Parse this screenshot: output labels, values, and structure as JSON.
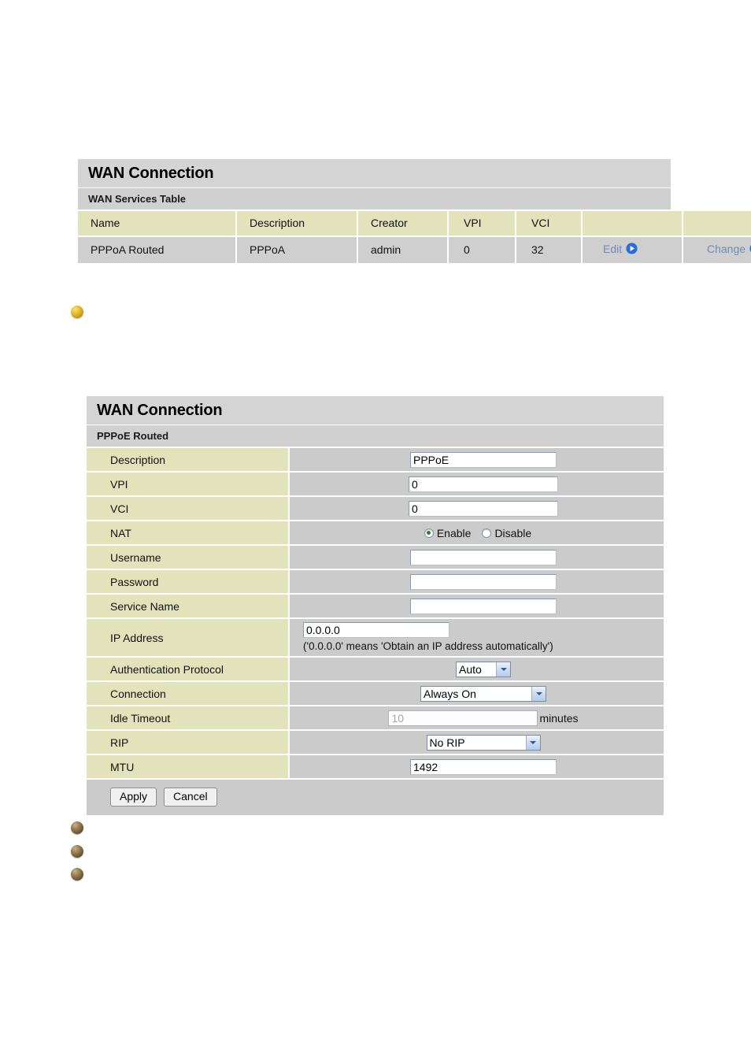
{
  "wan_services_panel": {
    "title": "WAN Connection",
    "subtitle": "WAN Services Table",
    "columns": [
      "Name",
      "Description",
      "Creator",
      "VPI",
      "VCI",
      "",
      ""
    ],
    "rows": [
      {
        "name": "PPPoA Routed",
        "description": "PPPoA",
        "creator": "admin",
        "vpi": "0",
        "vci": "32",
        "edit_label": "Edit",
        "change_label": "Change"
      }
    ],
    "link_color": "#6d8cb8",
    "header_bg": "#e2e2bb",
    "row_bg": "#cfcfcf"
  },
  "wan_form_panel": {
    "title": "WAN Connection",
    "subtitle": "PPPoE Routed",
    "fields": {
      "description": {
        "label": "Description",
        "value": "PPPoE"
      },
      "vpi": {
        "label": "VPI",
        "value": "0"
      },
      "vci": {
        "label": "VCI",
        "value": "0"
      },
      "nat": {
        "label": "NAT",
        "options": [
          "Enable",
          "Disable"
        ],
        "selected": "Enable"
      },
      "username": {
        "label": "Username",
        "value": ""
      },
      "password": {
        "label": "Password",
        "value": ""
      },
      "service_name": {
        "label": "Service Name",
        "value": ""
      },
      "ip_address": {
        "label": "IP Address",
        "value": "0.0.0.0",
        "note": "('0.0.0.0' means 'Obtain an IP address automatically')"
      },
      "auth_protocol": {
        "label": "Authentication Protocol",
        "value": "Auto"
      },
      "connection": {
        "label": "Connection",
        "value": "Always On"
      },
      "idle_timeout": {
        "label": "Idle Timeout",
        "value": "10",
        "unit": "minutes",
        "disabled": true
      },
      "rip": {
        "label": "RIP",
        "value": "No RIP"
      },
      "mtu": {
        "label": "MTU",
        "value": "1492"
      }
    },
    "buttons": {
      "apply": "Apply",
      "cancel": "Cancel"
    },
    "label_bg": "#e2e2bb",
    "value_bg": "#cbcbcb"
  },
  "bullets": {
    "gold_color": "#e6c232",
    "bronze_color": "#8a7046"
  }
}
